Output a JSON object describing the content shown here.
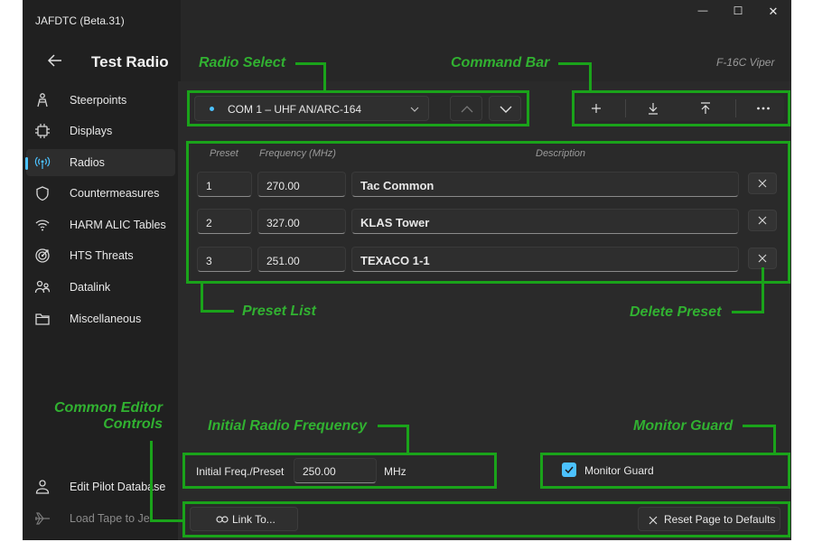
{
  "window": {
    "title": "JAFDTC (Beta.31)"
  },
  "window_controls": {
    "minimize": "—",
    "maximize": "☐",
    "close": "✕"
  },
  "header": {
    "back_icon": "arrow-left-icon",
    "title": "Test Radio",
    "airframe": "F-16C Viper"
  },
  "sidebar": {
    "items": [
      {
        "label": "Steerpoints",
        "icon": "steerpoint-person-icon"
      },
      {
        "label": "Displays",
        "icon": "chip-icon"
      },
      {
        "label": "Radios",
        "icon": "radio-waves-icon",
        "selected": true
      },
      {
        "label": "Countermeasures",
        "icon": "shield-icon"
      },
      {
        "label": "HARM ALIC Tables",
        "icon": "wifi-icon"
      },
      {
        "label": "HTS Threats",
        "icon": "target-icon"
      },
      {
        "label": "Datalink",
        "icon": "people-icon"
      },
      {
        "label": "Miscellaneous",
        "icon": "folder-icon"
      }
    ],
    "footer": [
      {
        "label": "Edit Pilot Database",
        "icon": "person-icon"
      },
      {
        "label": "Load Tape to Jet",
        "icon": "jet-icon",
        "disabled": true
      }
    ]
  },
  "radio_select": {
    "selected": "COM 1 – UHF AN/ARC-164"
  },
  "presets": {
    "headers": {
      "preset": "Preset",
      "frequency": "Frequency (MHz)",
      "description": "Description"
    },
    "rows": [
      {
        "preset": "1",
        "frequency": "270.00",
        "description": "Tac Common"
      },
      {
        "preset": "2",
        "frequency": "327.00",
        "description": "KLAS Tower"
      },
      {
        "preset": "3",
        "frequency": "251.00",
        "description": "TEXACO 1-1"
      }
    ]
  },
  "initial_freq": {
    "label": "Initial Freq./Preset",
    "value": "250.00",
    "unit": "MHz"
  },
  "monitor_guard": {
    "label": "Monitor Guard",
    "checked": true
  },
  "bottom_bar": {
    "link_label": "Link To...",
    "reset_label": "Reset Page to Defaults"
  },
  "annotations": {
    "radio_select": "Radio Select",
    "command_bar": "Command Bar",
    "preset_list": "Preset List",
    "delete_preset": "Delete Preset",
    "common_editor_line1": "Common Editor",
    "common_editor_line2": "Controls",
    "initial_radio_frequency": "Initial Radio Frequency",
    "monitor_guard": "Monitor Guard"
  },
  "colors": {
    "annotation_green": "#1aa31a",
    "accent_blue": "#4cc2ff",
    "background": "#272727",
    "sidebar": "#202020"
  }
}
